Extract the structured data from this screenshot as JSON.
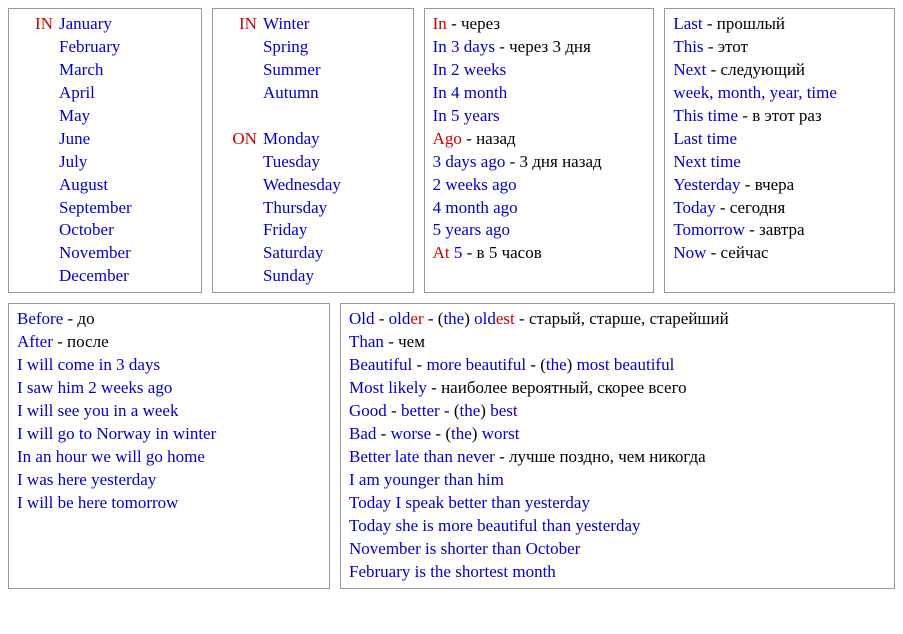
{
  "box1": {
    "label": "IN",
    "months": [
      "January",
      "February",
      "March",
      "April",
      "May",
      "June",
      "July",
      "August",
      "September",
      "October",
      "November",
      "December"
    ]
  },
  "box2": {
    "label_in": "IN",
    "seasons": [
      "Winter",
      "Spring",
      "Summer",
      "Autumn"
    ],
    "label_on": "ON",
    "days": [
      "Monday",
      "Tuesday",
      "Wednesday",
      "Thursday",
      "Friday",
      "Saturday",
      "Sunday"
    ]
  },
  "box3": {
    "l0a": "In",
    "l0b": " - через",
    "l1a": "In 3 days",
    "l1b": " - через 3 дня",
    "l2": "In 2 weeks",
    "l3": "In 4 month",
    "l4": "In 5 years",
    "l5a": "Ago",
    "l5b": " - назад",
    "l6a": "3 days ago",
    "l6b": " - 3 дня назад",
    "l7": "2 weeks ago",
    "l8": "4 month ago",
    "l9": "5 years ago",
    "l10a": "At",
    "l10b": " 5",
    "l10c": " - в 5 часов"
  },
  "box4": {
    "l0a": "Last",
    "l0b": " - прошлый",
    "l1a": "This",
    "l1b": " - этот",
    "l2a": "Next",
    "l2b": " - следующий",
    "l3": "week, month, year, time",
    "l4a": "This time",
    "l4b": " - в этот раз",
    "l5": "Last time",
    "l6": "Next time",
    "l7a": "Yesterday",
    "l7b": " - вчера",
    "l8a": "Today",
    "l8b": " - сегодня",
    "l9a": "Tomorrow",
    "l9b": " - завтра",
    "l10a": "Now",
    "l10b": " - сейчас"
  },
  "box5": {
    "l0a": "Before",
    "l0b": " - до",
    "l1a": "After",
    "l1b": " - после",
    "l2": "I will come in 3 days",
    "l3": "I saw him 2 weeks ago",
    "l4": "I will see you in a week",
    "l5": "I will go to Norway in winter",
    "l6": "In an hour we will go home",
    "l7": "I was here yesterday",
    "l8": "I will be here tomorrow"
  },
  "box6": {
    "l0a": "Old",
    "l0b": " - ",
    "l0c": "old",
    "l0d": "er",
    "l0e": " - (",
    "l0f": "the",
    "l0g": ") ",
    "l0h": "old",
    "l0i": "est",
    "l0j": " - старый, старше, старейший",
    "l1a": "Than",
    "l1b": " - чем",
    "l2a": "Beautiful",
    "l2b": " - ",
    "l2c": "more beautiful",
    "l2d": " - (",
    "l2e": "the",
    "l2f": ") ",
    "l2g": "most beautiful",
    "l3a": "Most likely",
    "l3b": " - наиболее вероятный, скорее всего",
    "l4a": "Good",
    "l4b": " - ",
    "l4c": "better",
    "l4d": " - (",
    "l4e": "the",
    "l4f": ") ",
    "l4g": "best",
    "l5a": "Bad",
    "l5b": " - ",
    "l5c": "worse",
    "l5d": " - (",
    "l5e": "the",
    "l5f": ") ",
    "l5g": "worst",
    "l6a": "Better late than never",
    "l6b": " - лучше поздно, чем никогда",
    "l7": "I am younger than him",
    "l8": "Today I speak better than yesterday",
    "l9": "Today she is more beautiful than yesterday",
    "l10": "November is shorter than October",
    "l11": "February is the shortest month"
  }
}
